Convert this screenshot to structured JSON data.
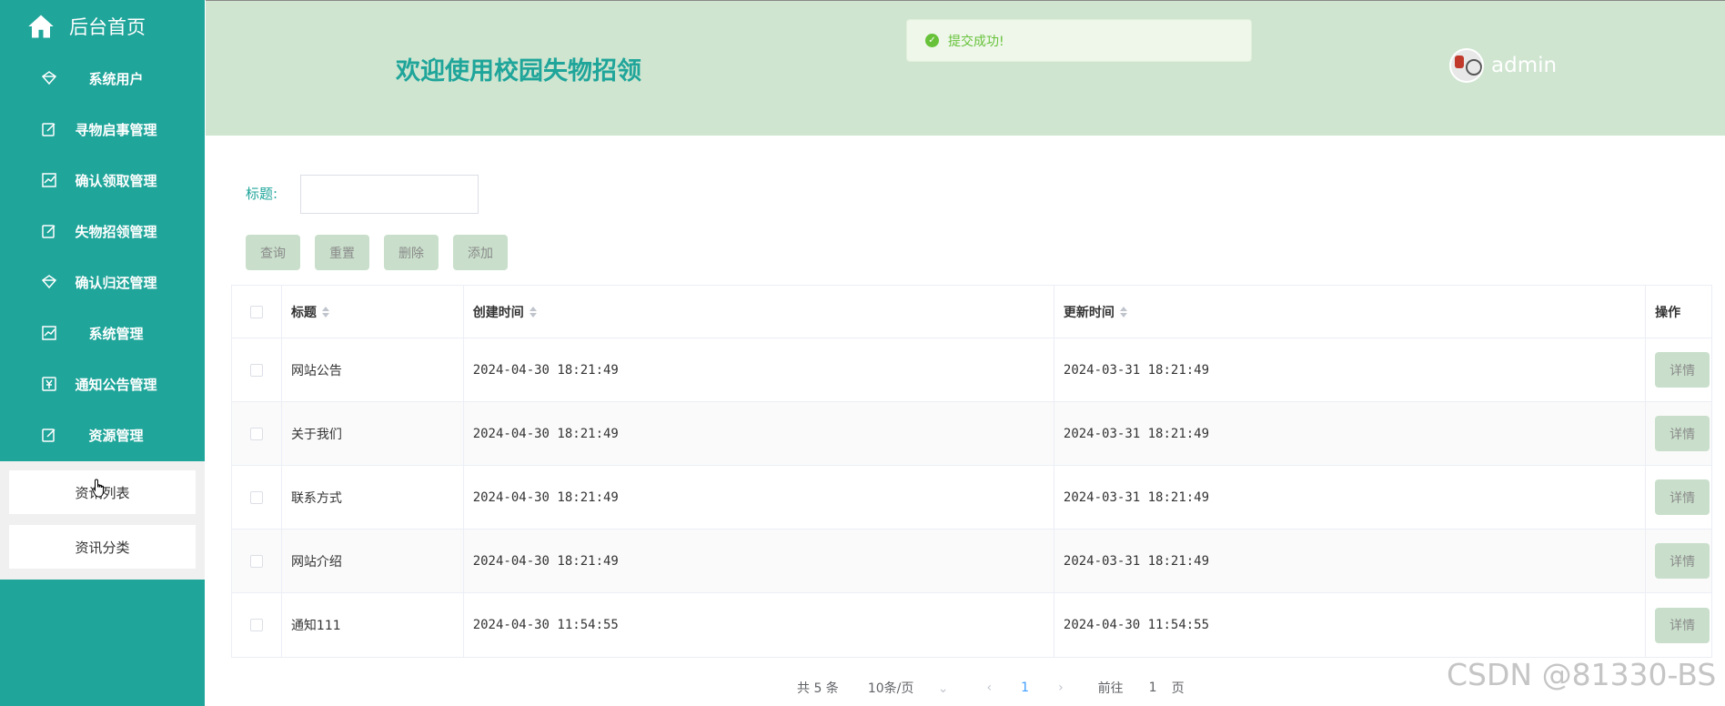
{
  "sidebar": {
    "home_label": "后台首页",
    "items": [
      {
        "label": "系统用户",
        "icon": "diamond-icon"
      },
      {
        "label": "寻物启事管理",
        "icon": "edit-icon"
      },
      {
        "label": "确认领取管理",
        "icon": "chart-icon"
      },
      {
        "label": "失物招领管理",
        "icon": "edit-icon"
      },
      {
        "label": "确认归还管理",
        "icon": "diamond-icon"
      },
      {
        "label": "系统管理",
        "icon": "chart-icon"
      },
      {
        "label": "通知公告管理",
        "icon": "money-icon"
      },
      {
        "label": "资源管理",
        "icon": "edit-icon"
      }
    ],
    "submenu": [
      "资讯列表",
      "资讯分类"
    ]
  },
  "header": {
    "title": "欢迎使用校园失物招领",
    "user": "admin"
  },
  "toast": {
    "message": "提交成功!"
  },
  "search": {
    "label": "标题:",
    "value": ""
  },
  "actions": {
    "query": "查询",
    "reset": "重置",
    "delete": "删除",
    "add": "添加"
  },
  "table": {
    "columns": [
      "标题",
      "创建时间",
      "更新时间",
      "操作"
    ],
    "detail_label": "详情",
    "rows": [
      {
        "title": "网站公告",
        "created": "2024-04-30 18:21:49",
        "updated": "2024-03-31 18:21:49"
      },
      {
        "title": "关于我们",
        "created": "2024-04-30 18:21:49",
        "updated": "2024-03-31 18:21:49"
      },
      {
        "title": "联系方式",
        "created": "2024-04-30 18:21:49",
        "updated": "2024-03-31 18:21:49"
      },
      {
        "title": "网站介绍",
        "created": "2024-04-30 18:21:49",
        "updated": "2024-03-31 18:21:49"
      },
      {
        "title": "通知111",
        "created": "2024-04-30 11:54:55",
        "updated": "2024-04-30 11:54:55"
      }
    ]
  },
  "pagination": {
    "total": "共 5 条",
    "page_size": "10条/页",
    "current": "1",
    "goto_prefix": "前往",
    "goto_value": "1",
    "goto_suffix": "页"
  },
  "watermark": "CSDN @81330-BS",
  "colors": {
    "sidebar": "#1fa59a",
    "header": "#cfe5d0",
    "button": "#c9dfcb",
    "success": "#67c23a"
  }
}
